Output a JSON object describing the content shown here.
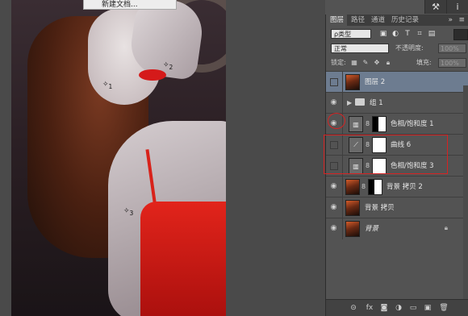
{
  "menu": {
    "new_doc_label": "新建文档..."
  },
  "image": {
    "marker1": "1",
    "marker2": "2",
    "marker3": "3"
  },
  "toolstrip": {
    "btn1_icon": "tool-preset-icon",
    "btn2_icon": "info-icon",
    "btn2_label": "i"
  },
  "panel": {
    "tabs": [
      "图层",
      "路径",
      "通道",
      "历史记录"
    ],
    "kind_filter": "ρ类型",
    "blend_mode": "正常",
    "opacity_label": "不透明度:",
    "opacity_value": "100%",
    "lock_label": "锁定:",
    "fill_label": "填充:",
    "fill_value": "100%",
    "layers": [
      {
        "name": "图层 2",
        "selected": true,
        "visible": false
      },
      {
        "name": "组 1",
        "type": "group",
        "visible": true
      },
      {
        "name": "色相/饱和度 1",
        "type": "adjustment",
        "visible": true
      },
      {
        "name": "曲线 6",
        "type": "adjustment",
        "visible": false
      },
      {
        "name": "色相/饱和度 3",
        "type": "adjustment",
        "visible": false
      },
      {
        "name": "背景 拷贝 2",
        "visible": true
      },
      {
        "name": "背景 拷贝",
        "visible": true
      },
      {
        "name": "背景",
        "visible": true,
        "locked": true
      }
    ]
  }
}
